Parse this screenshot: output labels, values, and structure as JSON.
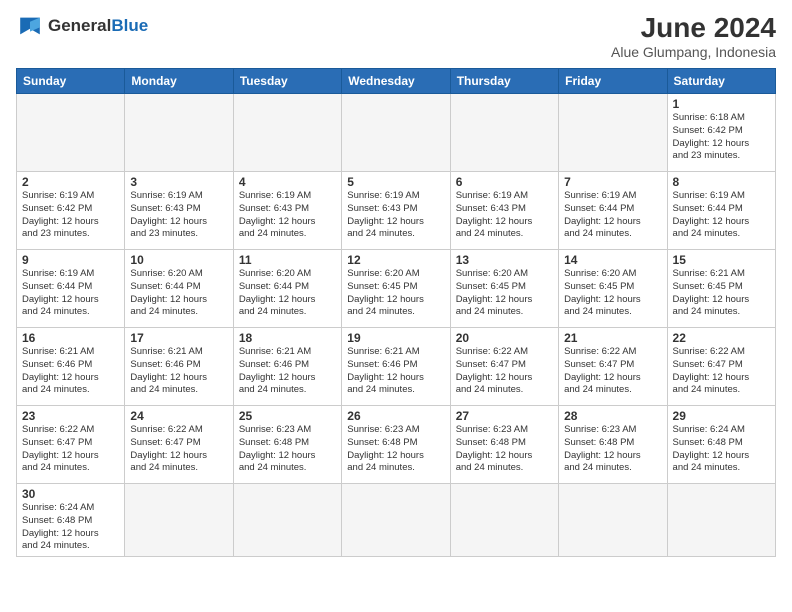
{
  "header": {
    "logo_general": "General",
    "logo_blue": "Blue",
    "month": "June 2024",
    "location": "Alue Glumpang, Indonesia"
  },
  "days_of_week": [
    "Sunday",
    "Monday",
    "Tuesday",
    "Wednesday",
    "Thursday",
    "Friday",
    "Saturday"
  ],
  "weeks": [
    [
      {
        "day": "",
        "info": ""
      },
      {
        "day": "",
        "info": ""
      },
      {
        "day": "",
        "info": ""
      },
      {
        "day": "",
        "info": ""
      },
      {
        "day": "",
        "info": ""
      },
      {
        "day": "",
        "info": ""
      },
      {
        "day": "1",
        "info": "Sunrise: 6:18 AM\nSunset: 6:42 PM\nDaylight: 12 hours\nand 23 minutes."
      }
    ],
    [
      {
        "day": "2",
        "info": "Sunrise: 6:19 AM\nSunset: 6:42 PM\nDaylight: 12 hours\nand 23 minutes."
      },
      {
        "day": "3",
        "info": "Sunrise: 6:19 AM\nSunset: 6:43 PM\nDaylight: 12 hours\nand 23 minutes."
      },
      {
        "day": "4",
        "info": "Sunrise: 6:19 AM\nSunset: 6:43 PM\nDaylight: 12 hours\nand 24 minutes."
      },
      {
        "day": "5",
        "info": "Sunrise: 6:19 AM\nSunset: 6:43 PM\nDaylight: 12 hours\nand 24 minutes."
      },
      {
        "day": "6",
        "info": "Sunrise: 6:19 AM\nSunset: 6:43 PM\nDaylight: 12 hours\nand 24 minutes."
      },
      {
        "day": "7",
        "info": "Sunrise: 6:19 AM\nSunset: 6:44 PM\nDaylight: 12 hours\nand 24 minutes."
      },
      {
        "day": "8",
        "info": "Sunrise: 6:19 AM\nSunset: 6:44 PM\nDaylight: 12 hours\nand 24 minutes."
      }
    ],
    [
      {
        "day": "9",
        "info": "Sunrise: 6:19 AM\nSunset: 6:44 PM\nDaylight: 12 hours\nand 24 minutes."
      },
      {
        "day": "10",
        "info": "Sunrise: 6:20 AM\nSunset: 6:44 PM\nDaylight: 12 hours\nand 24 minutes."
      },
      {
        "day": "11",
        "info": "Sunrise: 6:20 AM\nSunset: 6:44 PM\nDaylight: 12 hours\nand 24 minutes."
      },
      {
        "day": "12",
        "info": "Sunrise: 6:20 AM\nSunset: 6:45 PM\nDaylight: 12 hours\nand 24 minutes."
      },
      {
        "day": "13",
        "info": "Sunrise: 6:20 AM\nSunset: 6:45 PM\nDaylight: 12 hours\nand 24 minutes."
      },
      {
        "day": "14",
        "info": "Sunrise: 6:20 AM\nSunset: 6:45 PM\nDaylight: 12 hours\nand 24 minutes."
      },
      {
        "day": "15",
        "info": "Sunrise: 6:21 AM\nSunset: 6:45 PM\nDaylight: 12 hours\nand 24 minutes."
      }
    ],
    [
      {
        "day": "16",
        "info": "Sunrise: 6:21 AM\nSunset: 6:46 PM\nDaylight: 12 hours\nand 24 minutes."
      },
      {
        "day": "17",
        "info": "Sunrise: 6:21 AM\nSunset: 6:46 PM\nDaylight: 12 hours\nand 24 minutes."
      },
      {
        "day": "18",
        "info": "Sunrise: 6:21 AM\nSunset: 6:46 PM\nDaylight: 12 hours\nand 24 minutes."
      },
      {
        "day": "19",
        "info": "Sunrise: 6:21 AM\nSunset: 6:46 PM\nDaylight: 12 hours\nand 24 minutes."
      },
      {
        "day": "20",
        "info": "Sunrise: 6:22 AM\nSunset: 6:47 PM\nDaylight: 12 hours\nand 24 minutes."
      },
      {
        "day": "21",
        "info": "Sunrise: 6:22 AM\nSunset: 6:47 PM\nDaylight: 12 hours\nand 24 minutes."
      },
      {
        "day": "22",
        "info": "Sunrise: 6:22 AM\nSunset: 6:47 PM\nDaylight: 12 hours\nand 24 minutes."
      }
    ],
    [
      {
        "day": "23",
        "info": "Sunrise: 6:22 AM\nSunset: 6:47 PM\nDaylight: 12 hours\nand 24 minutes."
      },
      {
        "day": "24",
        "info": "Sunrise: 6:22 AM\nSunset: 6:47 PM\nDaylight: 12 hours\nand 24 minutes."
      },
      {
        "day": "25",
        "info": "Sunrise: 6:23 AM\nSunset: 6:48 PM\nDaylight: 12 hours\nand 24 minutes."
      },
      {
        "day": "26",
        "info": "Sunrise: 6:23 AM\nSunset: 6:48 PM\nDaylight: 12 hours\nand 24 minutes."
      },
      {
        "day": "27",
        "info": "Sunrise: 6:23 AM\nSunset: 6:48 PM\nDaylight: 12 hours\nand 24 minutes."
      },
      {
        "day": "28",
        "info": "Sunrise: 6:23 AM\nSunset: 6:48 PM\nDaylight: 12 hours\nand 24 minutes."
      },
      {
        "day": "29",
        "info": "Sunrise: 6:24 AM\nSunset: 6:48 PM\nDaylight: 12 hours\nand 24 minutes."
      }
    ],
    [
      {
        "day": "30",
        "info": "Sunrise: 6:24 AM\nSunset: 6:48 PM\nDaylight: 12 hours\nand 24 minutes."
      },
      {
        "day": "",
        "info": ""
      },
      {
        "day": "",
        "info": ""
      },
      {
        "day": "",
        "info": ""
      },
      {
        "day": "",
        "info": ""
      },
      {
        "day": "",
        "info": ""
      },
      {
        "day": "",
        "info": ""
      }
    ]
  ]
}
